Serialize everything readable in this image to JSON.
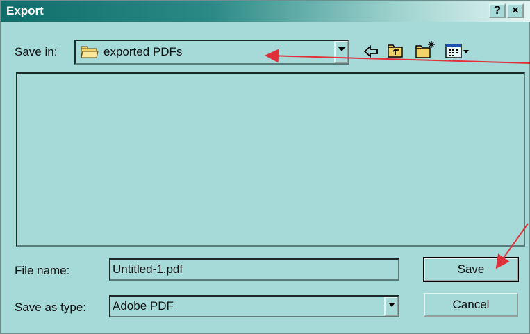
{
  "dialog": {
    "title": "Export",
    "help_label": "?",
    "close_label": "×"
  },
  "save_in": {
    "label": "Save in:",
    "value": "exported PDFs"
  },
  "toolbar": {
    "icons": [
      "back-icon",
      "up-folder-icon",
      "new-folder-icon",
      "view-menu-icon"
    ]
  },
  "file_name": {
    "label": "File name:",
    "value": "Untitled-1.pdf"
  },
  "save_as_type": {
    "label": "Save as type:",
    "value": "Adobe PDF"
  },
  "buttons": {
    "save": "Save",
    "cancel": "Cancel"
  },
  "colors": {
    "dialog_bg": "#a6dad8",
    "title_bar": "#0f6e6a",
    "annotation_arrow": "#e0303a"
  }
}
